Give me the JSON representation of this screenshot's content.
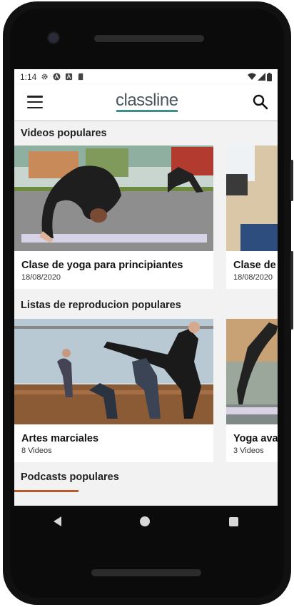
{
  "status": {
    "time": "1:14"
  },
  "app": {
    "logo_text": "classline",
    "logo_color": "#4a5560",
    "accent": "#3e8f8a"
  },
  "sections": {
    "videos": {
      "title": "Videos populares",
      "items": [
        {
          "title": "Clase de yoga para principiantes",
          "sub": "18/08/2020"
        },
        {
          "title": "Clase de yoga para principiantes",
          "sub": "18/08/2020"
        }
      ]
    },
    "playlists": {
      "title": "Listas de reproducion populares",
      "items": [
        {
          "title": "Artes marciales",
          "sub": "8 Videos"
        },
        {
          "title": "Yoga avanzado",
          "sub": "3 Videos"
        }
      ]
    },
    "podcasts": {
      "title": "Podcasts populares"
    }
  }
}
